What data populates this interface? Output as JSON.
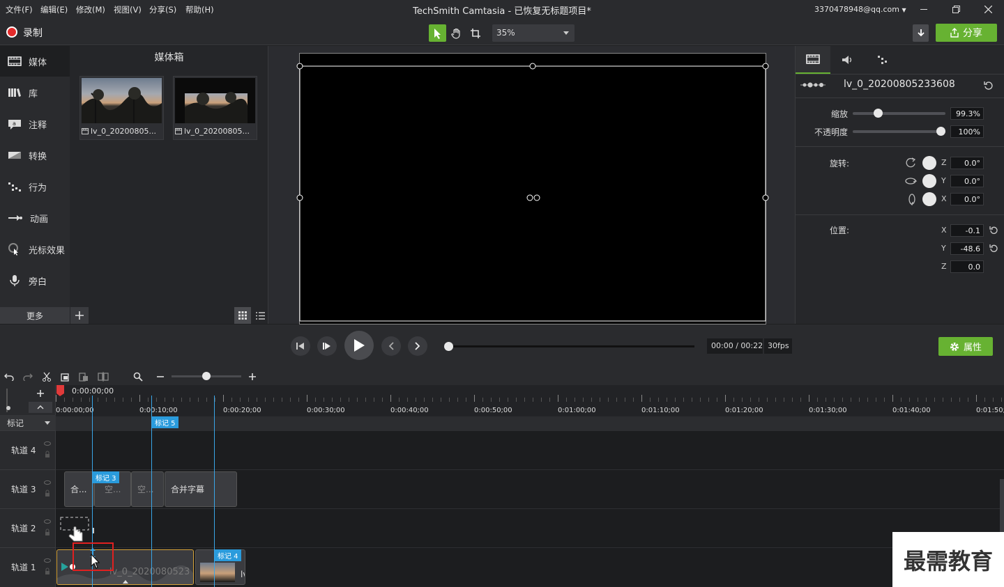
{
  "menu": [
    "文件(F)",
    "编辑(E)",
    "修改(M)",
    "视图(V)",
    "分享(S)",
    "帮助(H)"
  ],
  "window": {
    "title": "TechSmith Camtasia - 已恢复无标题项目*",
    "account": "3370478948@qq.com"
  },
  "toolbar": {
    "record_label": "录制",
    "zoom": "35%",
    "share_label": "分享"
  },
  "leftnav": {
    "items": [
      "媒体",
      "库",
      "注释",
      "转换",
      "行为",
      "动画",
      "光标效果",
      "旁白"
    ],
    "more_label": "更多"
  },
  "mediabin": {
    "title": "媒体箱",
    "items": [
      {
        "label": "lv_0_20200805..."
      },
      {
        "label": "lv_0_20200805..."
      }
    ]
  },
  "properties": {
    "clip_name": "lv_0_20200805233608",
    "scale_label": "缩放",
    "scale_value": "99.3%",
    "scale_level": 0.25,
    "opacity_label": "不透明度",
    "opacity_value": "100%",
    "opacity_level": 1.0,
    "rotation_label": "旋转:",
    "rotation": [
      {
        "axis": "Z",
        "value": "0.0°"
      },
      {
        "axis": "Y",
        "value": "0.0°"
      },
      {
        "axis": "X",
        "value": "0.0°"
      }
    ],
    "position_label": "位置:",
    "position": [
      {
        "axis": "X",
        "value": "-0.1"
      },
      {
        "axis": "Y",
        "value": "-48.6"
      },
      {
        "axis": "Z",
        "value": "0.0"
      }
    ],
    "button_label": "属性"
  },
  "playback": {
    "timecode": "00:00 / 00:22",
    "fps": "30fps",
    "progress": 0.0
  },
  "timeline": {
    "playhead_time": "0:00:00;00",
    "ruler_labels": [
      "0:00:00;00",
      "0:00:10;00",
      "0:00:20;00",
      "0:00:30;00",
      "0:00:40;00",
      "0:00:50;00",
      "0:01:00;00",
      "0:01:10;00",
      "0:01:20;00",
      "0:01:30;00",
      "0:01:40;00",
      "0:01:50;00"
    ],
    "markers_label": "标记",
    "markers": [
      "标记 5",
      "标记 3",
      "标记 4"
    ],
    "tracks": [
      "轨道 4",
      "轨道 3",
      "轨道 2",
      "轨道 1"
    ],
    "track3_clips": [
      "合...",
      "空...",
      "空...",
      "合并字幕"
    ],
    "track1_clip": "lv_0_2020080523",
    "track1_clip2": "lv"
  },
  "watermark": "最需教育"
}
